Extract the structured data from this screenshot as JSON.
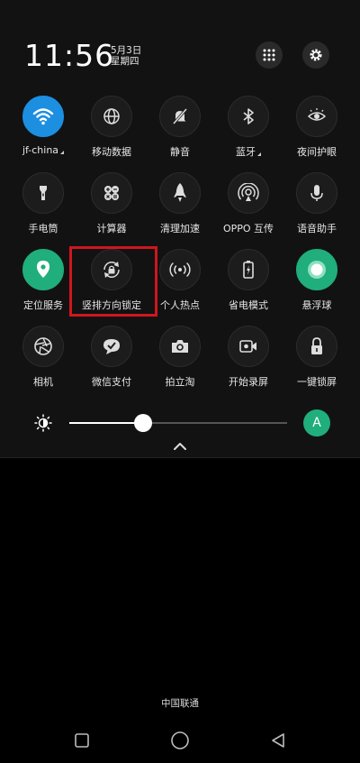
{
  "status": {
    "time": "11:56",
    "date_line1": "5月3日",
    "date_line2": "星期四"
  },
  "top_buttons": [
    {
      "name": "edit-tiles",
      "icon": "grid-dots-icon"
    },
    {
      "name": "settings",
      "icon": "gear-icon"
    }
  ],
  "tiles": [
    {
      "label": "jf-china",
      "icon": "wifi-icon",
      "state": "wifi"
    },
    {
      "label": "移动数据",
      "icon": "globe-icon",
      "state": "off"
    },
    {
      "label": "静音",
      "icon": "bell-off-icon",
      "state": "off"
    },
    {
      "label": "蓝牙",
      "icon": "bluetooth-icon",
      "state": "off"
    },
    {
      "label": "夜间护眼",
      "icon": "eye-icon",
      "state": "off"
    },
    {
      "label": "手电筒",
      "icon": "flashlight-icon",
      "state": "off"
    },
    {
      "label": "计算器",
      "icon": "calculator-icon",
      "state": "off"
    },
    {
      "label": "清理加速",
      "icon": "rocket-icon",
      "state": "off"
    },
    {
      "label": "OPPO 互传",
      "icon": "share-icon",
      "state": "off"
    },
    {
      "label": "语音助手",
      "icon": "microphone-icon",
      "state": "off"
    },
    {
      "label": "定位服务",
      "icon": "location-icon",
      "state": "active"
    },
    {
      "label": "竖排方向锁定",
      "icon": "rotation-lock-icon",
      "state": "off"
    },
    {
      "label": "个人热点",
      "icon": "hotspot-icon",
      "state": "off"
    },
    {
      "label": "省电模式",
      "icon": "battery-icon",
      "state": "off"
    },
    {
      "label": "悬浮球",
      "icon": "floating-ball-icon",
      "state": "active"
    },
    {
      "label": "相机",
      "icon": "camera-shutter-icon",
      "state": "off"
    },
    {
      "label": "微信支付",
      "icon": "wechat-pay-icon",
      "state": "off"
    },
    {
      "label": "拍立淘",
      "icon": "camera-icon",
      "state": "off"
    },
    {
      "label": "开始录屏",
      "icon": "video-record-icon",
      "state": "off"
    },
    {
      "label": "一键锁屏",
      "icon": "lock-icon",
      "state": "off"
    }
  ],
  "brightness": {
    "level": 0.34,
    "auto_label": "A"
  },
  "carrier": "中国联通",
  "colors": {
    "accent_green": "#1fae7c",
    "wifi_blue": "#1d8fe0",
    "highlight_red": "#d0161e"
  }
}
